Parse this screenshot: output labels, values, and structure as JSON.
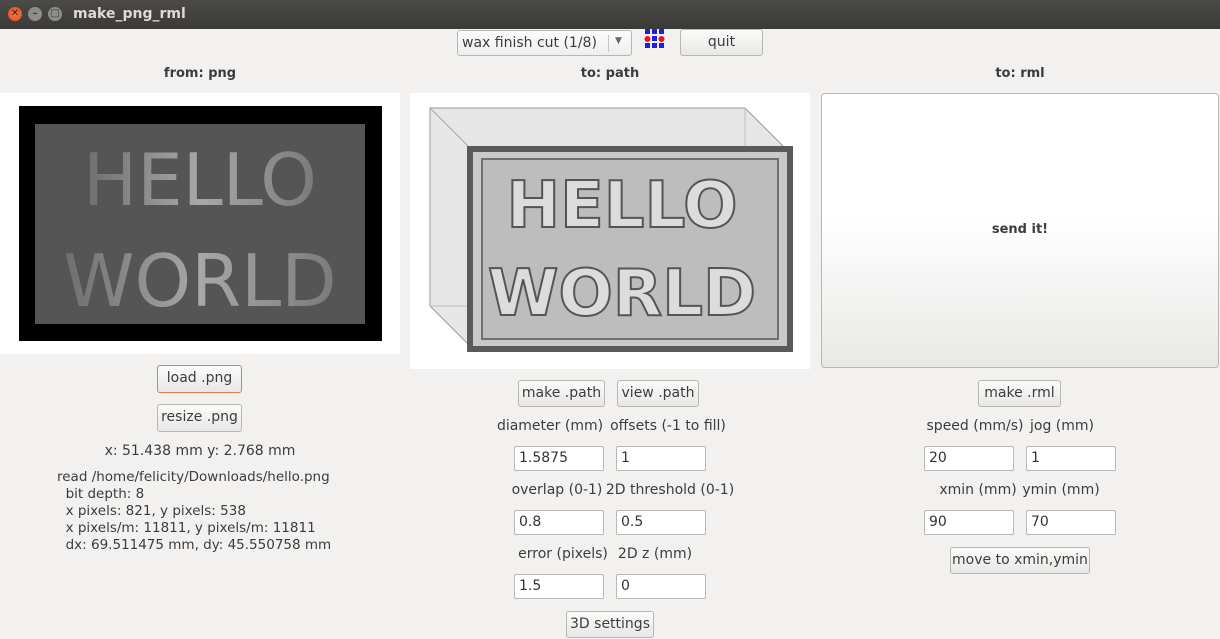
{
  "window": {
    "title": "make_png_rml"
  },
  "toolbar": {
    "process_select": "wax finish cut (1/8)",
    "quit_label": "quit"
  },
  "columns": {
    "png_heading": "from: png",
    "path_heading": "to: path",
    "rml_heading": "to: rml"
  },
  "png": {
    "image_text": [
      "HELLO",
      "WORLD"
    ],
    "load_label": "load .png",
    "resize_label": "resize .png",
    "coords": "x: 51.438 mm  y: 2.768 mm",
    "info": [
      "read /home/felicity/Downloads/hello.png",
      "  bit depth: 8",
      "  x pixels: 821, y pixels: 538",
      "  x pixels/m: 11811, y pixels/m: 11811",
      "  dx: 69.511475 mm, dy: 45.550758 mm"
    ]
  },
  "path": {
    "preview_text": [
      "HELLO",
      "WORLD"
    ],
    "make_label": "make .path",
    "view_label": "view .path",
    "diameter_label": "diameter (mm)",
    "diameter_value": "1.5875",
    "offsets_label": "offsets (-1 to fill)",
    "offsets_value": "1",
    "overlap_label": "overlap (0-1)",
    "overlap_value": "0.8",
    "threshold_label": "2D threshold (0-1)",
    "threshold_value": "0.5",
    "error_label": "error (pixels)",
    "error_value": "1.5",
    "z_label": "2D z (mm)",
    "z_value": "0",
    "settings3d_label": "3D settings"
  },
  "rml": {
    "send_label": "send it!",
    "make_label": "make .rml",
    "speed_label": "speed (mm/s)",
    "speed_value": "20",
    "jog_label": "jog (mm)",
    "jog_value": "1",
    "xmin_label": "xmin (mm)",
    "xmin_value": "90",
    "ymin_label": "ymin (mm)",
    "ymin_value": "70",
    "move_label": "move to xmin,ymin"
  },
  "colors": {
    "focus_border": "#e57a4c",
    "close_button": "#df4b16",
    "dot_red": "#e8141c",
    "dot_blue": "#1e1ee6"
  }
}
